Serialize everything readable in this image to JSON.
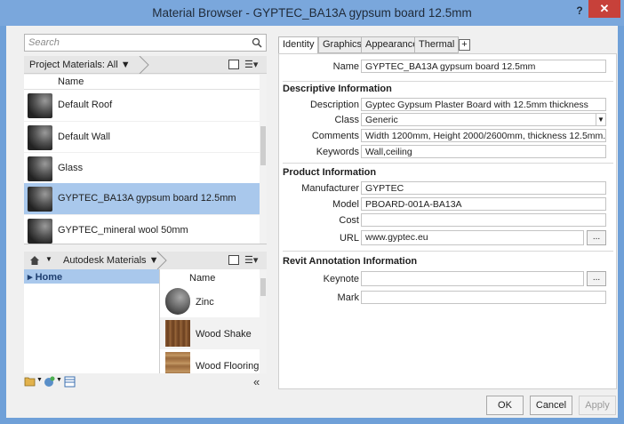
{
  "window": {
    "title": "Material Browser - GYPTEC_BA13A gypsum board 12.5mm",
    "help_label": "?",
    "close_label": "✕"
  },
  "search": {
    "placeholder": "Search"
  },
  "project_materials": {
    "filter_label": "Project Materials: All ▼",
    "column_header": "Name",
    "items": [
      {
        "label": "Default Roof",
        "selected": false
      },
      {
        "label": "Default Wall",
        "selected": false
      },
      {
        "label": "Glass",
        "selected": false
      },
      {
        "label": "GYPTEC_BA13A gypsum board 12.5mm",
        "selected": true
      },
      {
        "label": "GYPTEC_mineral wool 50mm",
        "selected": false
      }
    ]
  },
  "library": {
    "breadcrumb": "Autodesk Materials ▼",
    "tree": [
      {
        "label": "Home",
        "selected": true
      }
    ],
    "column_header": "Name",
    "items": [
      {
        "label": "Zinc",
        "icon": "zinc-swatch"
      },
      {
        "label": "Wood Shake",
        "icon": "wood-shake-swatch"
      },
      {
        "label": "Wood Flooring",
        "icon": "wood-flooring-swatch"
      }
    ],
    "collapse_label": "«"
  },
  "tabs": [
    {
      "label": "Identity",
      "active": true
    },
    {
      "label": "Graphics",
      "active": false
    },
    {
      "label": "Appearance",
      "active": false
    },
    {
      "label": "Thermal",
      "active": false
    }
  ],
  "add_tab_label": "+",
  "identity": {
    "name_label": "Name",
    "name_value": "GYPTEC_BA13A gypsum board 12.5mm",
    "descriptive": {
      "title": "Descriptive Information",
      "description_label": "Description",
      "description_value": "Gyptec Gypsum Plaster Board with 12.5mm thickness",
      "class_label": "Class",
      "class_value": "Generic",
      "comments_label": "Comments",
      "comments_value": "Width 1200mm, Height 2000/2600mm, thickness 12.5mm.",
      "keywords_label": "Keywords",
      "keywords_value": "Wall,ceiling"
    },
    "product": {
      "title": "Product Information",
      "manufacturer_label": "Manufacturer",
      "manufacturer_value": "GYPTEC",
      "model_label": "Model",
      "model_value": "PBOARD-001A-BA13A",
      "cost_label": "Cost",
      "cost_value": "",
      "url_label": "URL",
      "url_value": "www.gyptec.eu",
      "url_browse_label": "..."
    },
    "annotation": {
      "title": "Revit Annotation Information",
      "keynote_label": "Keynote",
      "keynote_value": "",
      "keynote_browse_label": "...",
      "mark_label": "Mark",
      "mark_value": ""
    }
  },
  "buttons": {
    "ok": "OK",
    "cancel": "Cancel",
    "apply": "Apply"
  },
  "colors": {
    "titlebar": "#7aa7dc",
    "selection": "#a9c8ec",
    "close": "#c7413a"
  }
}
